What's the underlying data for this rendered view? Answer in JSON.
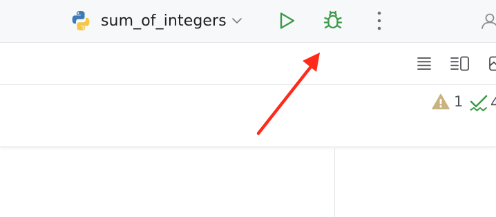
{
  "toolbar": {
    "run_config": {
      "name": "sum_of_integers",
      "icon": "python-icon"
    },
    "buttons": {
      "run": "run-icon",
      "debug": "debug-icon",
      "more": "more-vertical-icon",
      "user": "user-icon"
    },
    "colors": {
      "run": "#3c9a4a",
      "debug": "#3c9a4a",
      "python_blue": "#3e7bb6",
      "python_yellow": "#f6c747"
    }
  },
  "editor_bar": {
    "view_buttons": [
      "lines-view-icon",
      "split-view-icon",
      "image-view-icon"
    ]
  },
  "inspections": {
    "warnings": {
      "icon": "warning-icon",
      "count": "1"
    },
    "passed": {
      "icon": "check-icon",
      "count": "4"
    }
  },
  "annotation": {
    "type": "arrow",
    "color": "#ff2a1a"
  }
}
